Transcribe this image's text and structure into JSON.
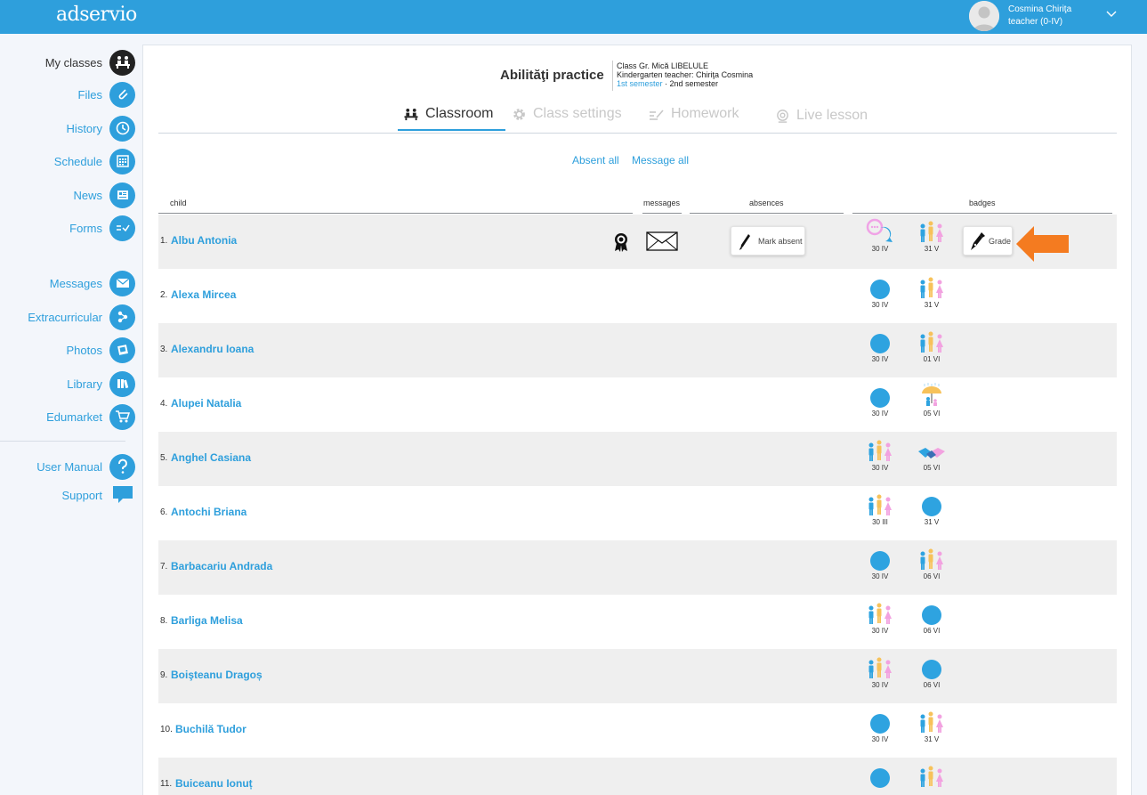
{
  "app": {
    "logo": "adservio"
  },
  "user": {
    "name": "Cosmina Chiriţa",
    "role": "teacher (0-IV)"
  },
  "sidebar": {
    "items": [
      {
        "label": "My classes",
        "icon": "classroom-icon"
      },
      {
        "label": "Files",
        "icon": "paperclip-icon"
      },
      {
        "label": "History",
        "icon": "history-clock-icon"
      },
      {
        "label": "Schedule",
        "icon": "calendar-grid-icon"
      },
      {
        "label": "News",
        "icon": "newspaper-icon"
      },
      {
        "label": "Forms",
        "icon": "form-check-icon"
      },
      {
        "label": "Messages",
        "icon": "envelope-icon"
      },
      {
        "label": "Extracurricular",
        "icon": "extracurricular-icon"
      },
      {
        "label": "Photos",
        "icon": "photos-icon"
      },
      {
        "label": "Library",
        "icon": "books-icon"
      },
      {
        "label": "Edumarket",
        "icon": "cart-icon"
      },
      {
        "label": "User Manual",
        "icon": "question-icon"
      },
      {
        "label": "Support",
        "icon": "chat-bubble-icon"
      }
    ]
  },
  "header": {
    "subject": "Abilităţi practice",
    "class_line": "Class Gr. Mică LIBELULE",
    "teacher_line": "Kindergarten teacher: Chiriţa Cosmina",
    "semester_active": "1st semester",
    "semester_separator": " · ",
    "semester_other": "2nd semester"
  },
  "tabs": [
    {
      "label": "Classroom",
      "active": true
    },
    {
      "label": "Class settings",
      "active": false
    },
    {
      "label": "Homework",
      "active": false
    },
    {
      "label": "Live lesson",
      "active": false
    }
  ],
  "actions": {
    "absent_all": "Absent all",
    "message_all": "Message all"
  },
  "columns": {
    "child": "child",
    "messages": "messages",
    "absences": "absences",
    "badges": "badges"
  },
  "buttons": {
    "mark_absent": "Mark absent",
    "grade": "Grade"
  },
  "colors": {
    "accent": "#2e9fdc",
    "highlight_arrow": "#f47b20"
  },
  "students": [
    {
      "num": "1.",
      "name": "Albu Antonia",
      "badges": [
        {
          "type": "chat",
          "date": "30 IV"
        },
        {
          "type": "family",
          "date": "31 V"
        }
      ]
    },
    {
      "num": "2.",
      "name": "Alexa Mircea",
      "badges": [
        {
          "type": "dot",
          "date": "30 IV"
        },
        {
          "type": "family",
          "date": "31 V"
        }
      ]
    },
    {
      "num": "3.",
      "name": "Alexandru Ioana",
      "badges": [
        {
          "type": "dot",
          "date": "30 IV"
        },
        {
          "type": "family",
          "date": "01 VI"
        }
      ]
    },
    {
      "num": "4.",
      "name": "Alupei Natalia",
      "badges": [
        {
          "type": "dot",
          "date": "30 IV"
        },
        {
          "type": "umbrella",
          "date": "05 VI"
        }
      ]
    },
    {
      "num": "5.",
      "name": "Anghel Casiana",
      "badges": [
        {
          "type": "family",
          "date": "30 IV"
        },
        {
          "type": "handshake",
          "date": "05 VI"
        }
      ]
    },
    {
      "num": "6.",
      "name": "Antochi Briana",
      "badges": [
        {
          "type": "family",
          "date": "30 III"
        },
        {
          "type": "dot",
          "date": "31 V"
        }
      ]
    },
    {
      "num": "7.",
      "name": "Barbacariu Andrada",
      "badges": [
        {
          "type": "dot",
          "date": "30 IV"
        },
        {
          "type": "family",
          "date": "06 VI"
        }
      ]
    },
    {
      "num": "8.",
      "name": "Barliga Melisa",
      "badges": [
        {
          "type": "family",
          "date": "30 IV"
        },
        {
          "type": "dot",
          "date": "06 VI"
        }
      ]
    },
    {
      "num": "9.",
      "name": "Boişteanu Dragoș",
      "badges": [
        {
          "type": "family",
          "date": "30 IV"
        },
        {
          "type": "dot",
          "date": "06 VI"
        }
      ]
    },
    {
      "num": "10.",
      "name": "Buchilă Tudor",
      "badges": [
        {
          "type": "dot",
          "date": "30 IV"
        },
        {
          "type": "family",
          "date": "31 V"
        }
      ]
    },
    {
      "num": "11.",
      "name": "Buiceanu Ionuț",
      "badges": [
        {
          "type": "dot",
          "date": ""
        },
        {
          "type": "family",
          "date": ""
        }
      ]
    }
  ]
}
